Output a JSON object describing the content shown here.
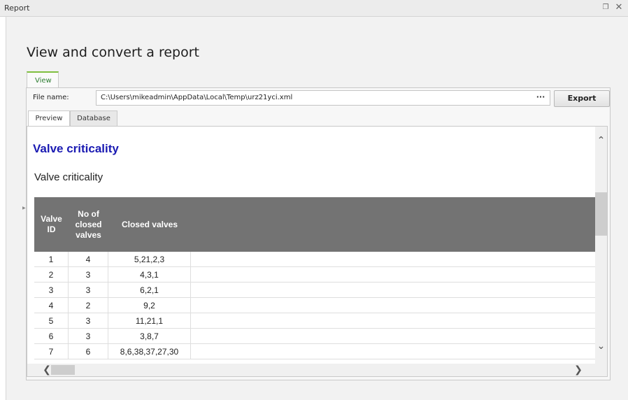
{
  "window": {
    "title": "Report",
    "restore_glyph": "❐",
    "close_glyph": "✕"
  },
  "heading": "View and convert a report",
  "outer_tab": {
    "label": "View"
  },
  "file": {
    "label": "File name:",
    "value": "C:\\Users\\mikeadmin\\AppData\\Local\\Temp\\urz21yci.xml",
    "browse_label": "···"
  },
  "export_label": "Export",
  "tabs": [
    {
      "label": "Preview",
      "active": true
    },
    {
      "label": "Database",
      "active": false
    }
  ],
  "report": {
    "title": "Valve criticality",
    "subtitle": "Valve criticality",
    "columns": [
      "Valve ID",
      "No of closed valves",
      "Closed valves"
    ],
    "rows": [
      {
        "id": "1",
        "count": "4",
        "valves": "5,21,2,3"
      },
      {
        "id": "2",
        "count": "3",
        "valves": "4,3,1"
      },
      {
        "id": "3",
        "count": "3",
        "valves": "6,2,1"
      },
      {
        "id": "4",
        "count": "2",
        "valves": "9,2"
      },
      {
        "id": "5",
        "count": "3",
        "valves": "11,21,1"
      },
      {
        "id": "6",
        "count": "3",
        "valves": "3,8,7"
      },
      {
        "id": "7",
        "count": "6",
        "valves": "8,6,38,37,27,30"
      }
    ]
  },
  "colors": {
    "accent_green": "#7fbf3f",
    "report_title_blue": "#1a1ab2",
    "table_header_gray": "#737373"
  },
  "icons": {
    "scroll_up": "chevron-up-icon",
    "scroll_down": "chevron-down-icon",
    "scroll_left": "chevron-left-icon",
    "scroll_right": "chevron-right-icon"
  }
}
